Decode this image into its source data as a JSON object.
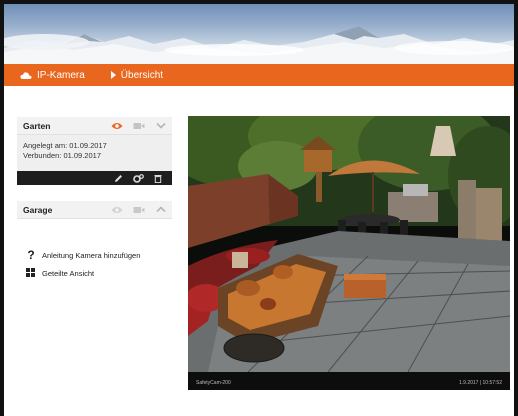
{
  "nav": {
    "home_label": "IP-Kamera",
    "overview_label": "Übersicht"
  },
  "cameras": [
    {
      "name": "Garten",
      "created_label": "Angelegt am: 01.09.2017",
      "connected_label": "Verbunden: 01.09.2017",
      "expanded": true
    },
    {
      "name": "Garage",
      "expanded": false
    }
  ],
  "links": {
    "add_guide": "Anleitung Kamera hinzufügen",
    "shared_view": "Geteilte Ansicht"
  },
  "camera_view": {
    "overlay_left": "SafetyCam-200",
    "overlay_right": "1.9.2017 | 10:57:52"
  },
  "colors": {
    "accent": "#e9661f",
    "card_dark": "#1e1e1e",
    "eye_active": "#e9661f"
  },
  "icons": {
    "home": "cloud-camera-icon",
    "eye": "eye-icon",
    "video": "video-camera-icon",
    "chevron_down": "chevron-down-icon",
    "chevron_up": "chevron-up-icon",
    "edit": "pencil-icon",
    "settings": "gears-icon",
    "delete": "trash-icon",
    "help": "question-mark-icon",
    "grid": "grid-view-icon"
  }
}
